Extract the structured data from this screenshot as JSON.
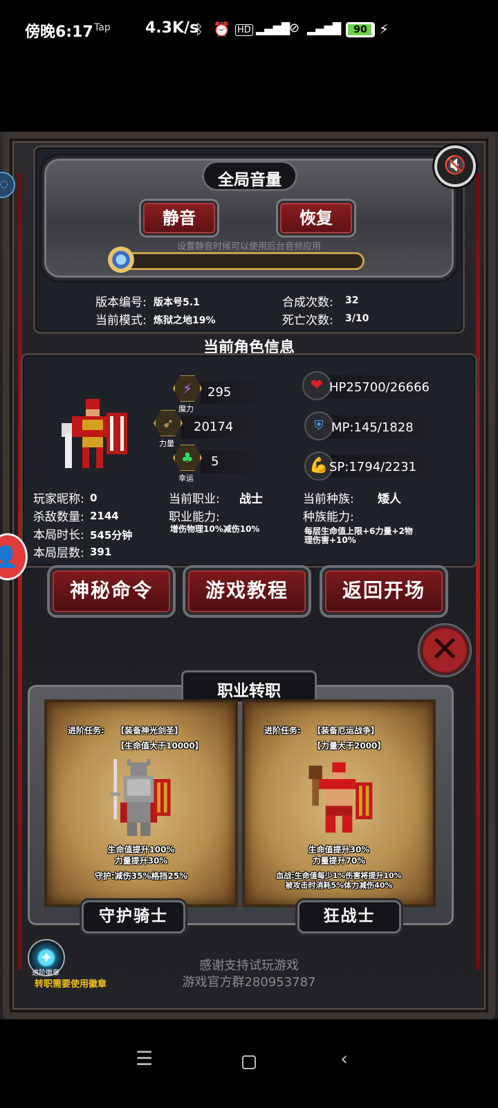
{
  "status_bar": {
    "time": "傍晚6:17",
    "tap": "Tap",
    "speed": "4.3K/s",
    "battery": "90",
    "battery_level": 0.9,
    "icons": [
      "bluetooth-icon",
      "alarm-icon",
      "hd-icon",
      "signal-4g-icon",
      "wifi-off-icon",
      "signal-4g-icon",
      "battery-icon",
      "charging-icon"
    ]
  },
  "volume": {
    "title": "全局音量",
    "mute_label": "静音",
    "restore_label": "恢复",
    "hint": "设置静音时候可以使用后台音频应用",
    "slider_level": 0
  },
  "game_info": {
    "version_label": "版本编号:",
    "version_value": "版本号5.1",
    "mode_label": "当前模式:",
    "mode_value": "炼狱之地19%",
    "merge_label": "合成次数:",
    "merge_value": "32",
    "death_label": "死亡次数:",
    "death_value": "3/10"
  },
  "character": {
    "section_title": "当前角色信息",
    "magic_value": "295",
    "magic_label": "魔力",
    "power_value": "20174",
    "power_label": "力量",
    "luck_value": "5",
    "luck_label": "幸运",
    "hp": "HP25700/26666",
    "mp": "MP:145/1828",
    "sp": "SP:1794/2231",
    "nickname_label": "玩家昵称:",
    "nickname_value": "0",
    "kills_label": "杀敌数量:",
    "kills_value": "2144",
    "duration_label": "本局时长:",
    "duration_value": "545分钟",
    "floor_label": "本局层数:",
    "floor_value": "391",
    "job_label": "当前职业:",
    "job_value": "战士",
    "job_ability_label": "职业能力:",
    "job_ability_value": "增伤物理10%减伤10%",
    "race_label": "当前种族:",
    "race_value": "矮人",
    "race_ability_label": "种族能力:",
    "race_ability_line1": "每层生命值上限+6力量+2物",
    "race_ability_line2": "理伤害+10%"
  },
  "actions": {
    "secret_label": "神秘命令",
    "tutorial_label": "游戏教程",
    "return_label": "返回开场"
  },
  "class_change": {
    "title": "职业转职",
    "left": {
      "quest_label": "进阶任务:",
      "quest_1": "【装备神光剑圣】",
      "quest_2": "【生命值大于10000】",
      "bonus_1": "生命值提升100%",
      "bonus_2": "力量提升30%",
      "skill": "守护:减伤35%格挡25%",
      "name": "守护骑士"
    },
    "right": {
      "quest_label": "进阶任务:",
      "quest_1": "【装备厄运战争】",
      "quest_2": "【力量大于2000】",
      "bonus_1": "生命值提升30%",
      "bonus_2": "力量提升70%",
      "skill_1": "血战:生命值每少1%伤害将提升10%",
      "skill_2": "被攻击时消耗5%体力减伤40%",
      "name": "狂战士"
    }
  },
  "footer": {
    "badge_label": "进阶徽章",
    "badge_note": "转职需要使用徽章",
    "thanks": "感谢支持试玩游戏",
    "group": "游戏官方群280953787"
  },
  "colors": {
    "button_red": "#7c1a1d",
    "gold": "#c9a24a",
    "badge_note": "#f0c020"
  }
}
